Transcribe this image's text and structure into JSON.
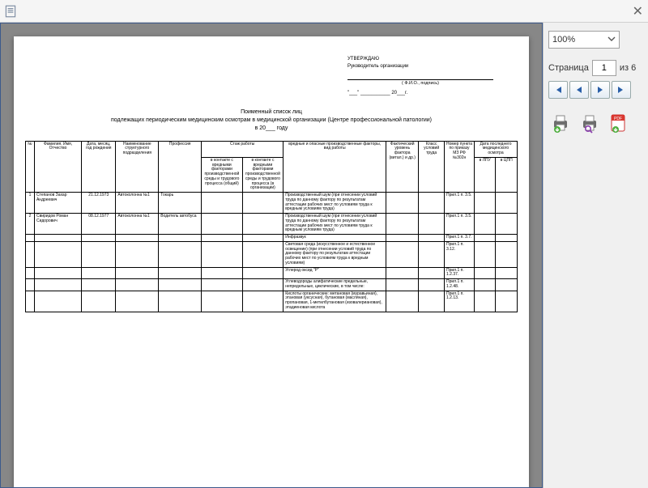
{
  "window": {
    "close_glyph": "✕"
  },
  "sidebar": {
    "zoom": "100%",
    "page_label": "Страница",
    "page_current": "1",
    "page_total_prefix": "из",
    "page_total": "6"
  },
  "approve": {
    "title": "УТВЕРЖДАЮ",
    "subtitle": "Руководитель организации",
    "fio_hint": "( Ф.И.О., подпись)",
    "date_tpl_left": "\"___\" ___________",
    "date_tpl_right": "20___г."
  },
  "doc": {
    "title1": "Поименный список лиц",
    "title2": "подлежащих периодическим медицинским осмотрам в медицинской организации (Центре профессиональной патологии)",
    "title3": "в 20___ году"
  },
  "columns": {
    "c1": "№",
    "c2": "Фамилия, Имя, Отчество",
    "c3": "Дата, месяц, год рождения",
    "c4": "Наименование структурного подразделения",
    "c5": "Профессия",
    "c6": "Стаж работы",
    "c6a": "в контакте с вредными факторами производственной среды и трудового процесса (общий)",
    "c6b": "в контакте с вредными факторами производственной среды и трудового процесса (в организации)",
    "c7": "вредные и опасные производственные факторы, вид работы",
    "c8": "Фактический уровень фактора (витал.) и др.)",
    "c9": "Класс условий труда",
    "c10": "Номер пункта по приказу МЗ РФ №302н",
    "c11": "Дата последнего медицинского осмотра",
    "c11a": "в ЛПУ",
    "c11b": "в ЦПП"
  },
  "rows": [
    {
      "n": "1",
      "fio": "Степанов Захар Андреевич",
      "dob": "21.12.1973",
      "dept": "Автоколонна №1",
      "prof": "Токарь",
      "s1": "",
      "s2": "",
      "factor": "Производственный шум (при отнесении условий труда по данному фактору по результатам аттестации рабочих мест по условиям труда к вредным условиям труда)",
      "lvl": "",
      "cls": "",
      "order": "Прил.1 п. 3.5.",
      "d1": "",
      "d2": ""
    },
    {
      "n": "2",
      "fio": "Свиридов Роман Сидорович",
      "dob": "08.12.1977",
      "dept": "Автоколонна №1",
      "prof": "Водитель автобуса",
      "s1": "",
      "s2": "",
      "factor": "Производственный шум (при отнесении условий труда по данному фактору по результатам аттестации рабочих мест по условиям труда к вредным условиям труда)",
      "lvl": "",
      "cls": "",
      "order": "Прил.1 п. 3.5.",
      "d1": "",
      "d2": ""
    },
    {
      "n": "",
      "fio": "",
      "dob": "",
      "dept": "",
      "prof": "",
      "s1": "",
      "s2": "",
      "factor": "Инфразвук",
      "lvl": "",
      "cls": "",
      "order": "Прил.1 п. 3.7.",
      "d1": "",
      "d2": ""
    },
    {
      "n": "",
      "fio": "",
      "dob": "",
      "dept": "",
      "prof": "",
      "s1": "",
      "s2": "",
      "factor": "Световая среда (искусственное и естественное освещение) (при отнесении условий труда по данному фактору по результатам аттестации рабочих мест по условиям труда к вредным условиям)",
      "lvl": "",
      "cls": "",
      "order": "Прил.1 п. 3.12.",
      "d1": "",
      "d2": ""
    },
    {
      "n": "",
      "fio": "",
      "dob": "",
      "dept": "",
      "prof": "",
      "s1": "",
      "s2": "",
      "factor": "Углерод оксид \"Р\"",
      "lvl": "",
      "cls": "",
      "order": "Прил.1 п. 1.2.37.",
      "d1": "",
      "d2": ""
    },
    {
      "n": "",
      "fio": "",
      "dob": "",
      "dept": "",
      "prof": "",
      "s1": "",
      "s2": "",
      "factor": "Углеводороды алифатические предельные, непредельные, циклические, в том числе:",
      "lvl": "",
      "cls": "",
      "order": "Прил.1 п. 1.2.48.",
      "d1": "",
      "d2": ""
    },
    {
      "n": "",
      "fio": "",
      "dob": "",
      "dept": "",
      "prof": "",
      "s1": "",
      "s2": "",
      "factor": "Кислоты органические: метановая (муравьиная), этановая (уксусная), бутановая (масляная), пропановая, 1-метилбутановая (изовалериановая), этадиеновая кислота",
      "lvl": "",
      "cls": "",
      "order": "Прил.1 п. 1.2.13.",
      "d1": "",
      "d2": ""
    }
  ]
}
